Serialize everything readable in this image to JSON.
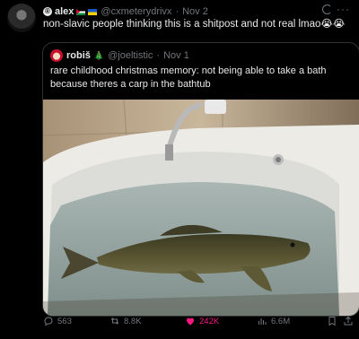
{
  "tweet": {
    "username": "alex",
    "handle": "@cxmeterydrivx",
    "separator": "·",
    "time": "Nov 2",
    "text": "non-slavic people thinking this is a shitpost and not real lmao😭😭",
    "verify_glyph": "®"
  },
  "quoted": {
    "username": "robiš",
    "tree_emoji": "🎄",
    "handle": "@joeltistic",
    "separator": "·",
    "time": "Nov 1",
    "text": "rare childhood christmas memory: not being able to take a bath because theres a carp in the bathtub"
  },
  "actions": {
    "replies": "563",
    "reposts": "8.8K",
    "likes": "242K",
    "views": "6.6M"
  },
  "colors": {
    "background": "#000000",
    "text": "#e7e9ea",
    "muted": "#71767b",
    "like": "#f91880",
    "border": "#2f3336"
  },
  "icons": [
    "grok-icon",
    "more-icon",
    "reply-icon",
    "repost-icon",
    "heart-icon",
    "views-icon",
    "bookmark-icon",
    "share-icon"
  ]
}
